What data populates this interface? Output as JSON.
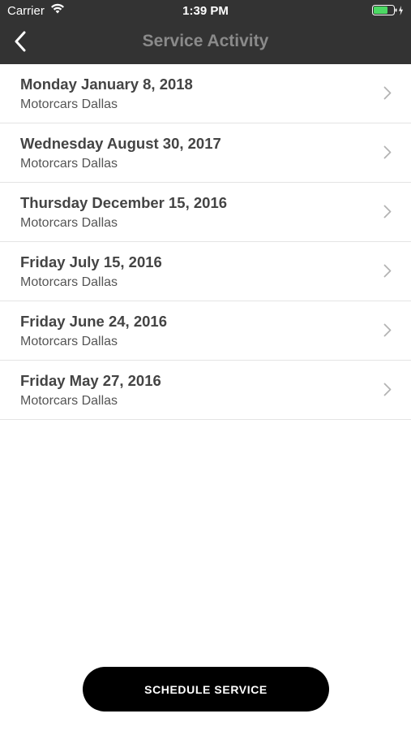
{
  "status_bar": {
    "carrier": "Carrier",
    "time": "1:39 PM"
  },
  "nav": {
    "back_icon": "chevron-left-icon",
    "title": "Service Activity"
  },
  "service_list": [
    {
      "date": "Monday January 8, 2018",
      "dealer": "Motorcars Dallas"
    },
    {
      "date": "Wednesday August 30, 2017",
      "dealer": "Motorcars Dallas"
    },
    {
      "date": "Thursday December 15, 2016",
      "dealer": "Motorcars Dallas"
    },
    {
      "date": "Friday July 15, 2016",
      "dealer": "Motorcars Dallas"
    },
    {
      "date": "Friday June 24, 2016",
      "dealer": "Motorcars Dallas"
    },
    {
      "date": "Friday May 27, 2016",
      "dealer": "Motorcars Dallas"
    }
  ],
  "schedule_button": {
    "label": "SCHEDULE SERVICE"
  },
  "colors": {
    "header_bg": "#333333",
    "title": "#8a8a8a",
    "battery": "#4cd964",
    "button_bg": "#000000"
  }
}
